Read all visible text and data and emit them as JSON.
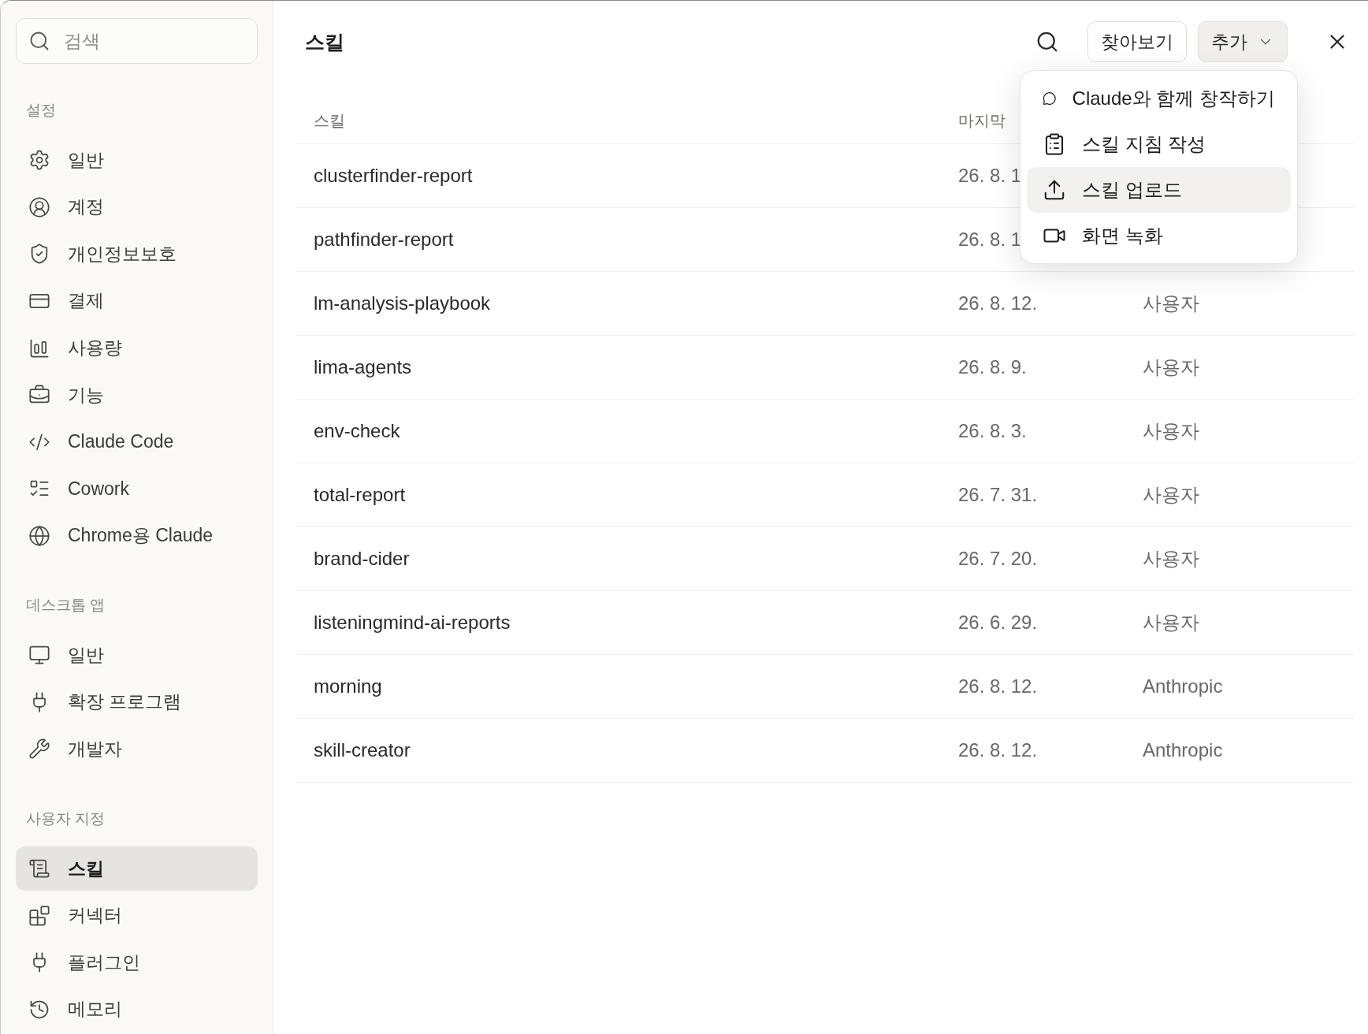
{
  "sidebar": {
    "search": {
      "placeholder": "검색"
    },
    "sections": [
      {
        "title": "설정",
        "items": [
          {
            "label": "일반",
            "selected": false
          },
          {
            "label": "계정",
            "selected": false
          },
          {
            "label": "개인정보보호",
            "selected": false
          },
          {
            "label": "결제",
            "selected": false
          },
          {
            "label": "사용량",
            "selected": false
          },
          {
            "label": "기능",
            "selected": false
          },
          {
            "label": "Claude Code",
            "selected": false
          },
          {
            "label": "Cowork",
            "selected": false
          },
          {
            "label": "Chrome용 Claude",
            "selected": false
          }
        ]
      },
      {
        "title": "데스크톱 앱",
        "items": [
          {
            "label": "일반",
            "selected": false
          },
          {
            "label": "확장 프로그램",
            "selected": false
          },
          {
            "label": "개발자",
            "selected": false
          }
        ]
      },
      {
        "title": "사용자 지정",
        "items": [
          {
            "label": "스킬",
            "selected": true
          },
          {
            "label": "커넥터",
            "selected": false
          },
          {
            "label": "플러그인",
            "selected": false
          },
          {
            "label": "메모리",
            "selected": false
          }
        ]
      }
    ]
  },
  "header": {
    "title": "스킬",
    "browse_button": "찾아보기",
    "add_button": {
      "label": "추가",
      "expanded": true
    }
  },
  "menu": {
    "items": [
      {
        "label": "Claude와 함께 창작하기",
        "selected": false
      },
      {
        "label": "스킬 지침 작성",
        "selected": false
      },
      {
        "label": "스킬 업로드",
        "selected": true
      },
      {
        "label": "화면 녹화",
        "selected": false
      }
    ]
  },
  "table": {
    "columns": [
      "스킬",
      "마지막"
    ],
    "rows": [
      {
        "name": "clusterfinder-report",
        "updated": "26. 8. 1"
      },
      {
        "name": "pathfinder-report",
        "updated": "26. 8. 1"
      },
      {
        "name": "lm-analysis-playbook",
        "updated": "26. 8. 12.",
        "source": "사용자"
      },
      {
        "name": "lima-agents",
        "updated": "26. 8. 9.",
        "source": "사용자"
      },
      {
        "name": "env-check",
        "updated": "26. 8. 3.",
        "source": "사용자"
      },
      {
        "name": "total-report",
        "updated": "26. 7. 31.",
        "source": "사용자"
      },
      {
        "name": "brand-cider",
        "updated": "26. 7. 20.",
        "source": "사용자"
      },
      {
        "name": "listeningmind-ai-reports",
        "updated": "26. 6. 29.",
        "source": "사용자"
      },
      {
        "name": "morning",
        "updated": "26. 8. 12.",
        "source": "Anthropic"
      },
      {
        "name": "skill-creator",
        "updated": "26. 8. 12.",
        "source": "Anthropic"
      }
    ]
  }
}
